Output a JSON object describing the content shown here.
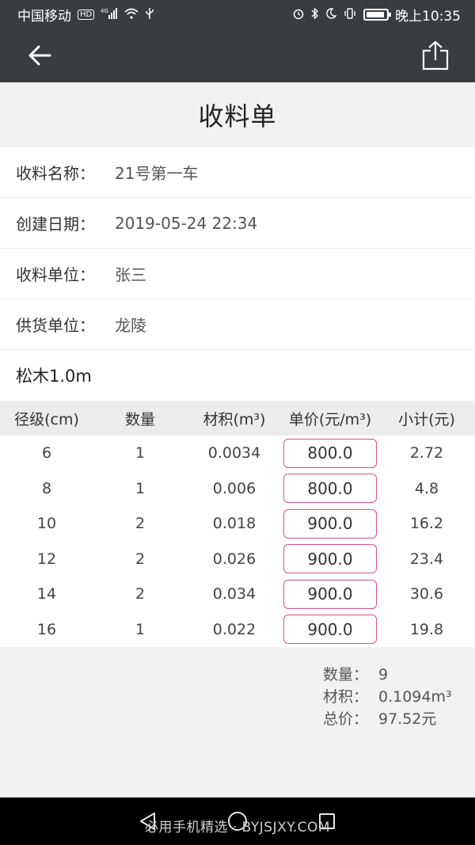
{
  "status_bar": {
    "carrier": "中国移动",
    "hd": "HD",
    "network": "4G",
    "time": "晚上10:35",
    "battery_level": 0.9
  },
  "app_bar": {
    "back_icon": "arrow-left-icon",
    "share_icon": "share-icon"
  },
  "page": {
    "title": "收料单"
  },
  "info": [
    {
      "label": "收料名称：",
      "value": "21号第一车"
    },
    {
      "label": "创建日期：",
      "value": "2019-05-24 22:34"
    },
    {
      "label": "收料单位：",
      "value": "张三"
    },
    {
      "label": "供货单位：",
      "value": "龙陵"
    }
  ],
  "section": {
    "title": "松木1.0m"
  },
  "table": {
    "headers": [
      "径级(cm)",
      "数量",
      "材积(m³)",
      "单价(元/m³)",
      "小计(元)"
    ],
    "rows": [
      {
        "diameter": "6",
        "qty": "1",
        "volume": "0.0034",
        "price": "800.0",
        "subtotal": "2.72"
      },
      {
        "diameter": "8",
        "qty": "1",
        "volume": "0.006",
        "price": "800.0",
        "subtotal": "4.8"
      },
      {
        "diameter": "10",
        "qty": "2",
        "volume": "0.018",
        "price": "900.0",
        "subtotal": "16.2"
      },
      {
        "diameter": "12",
        "qty": "2",
        "volume": "0.026",
        "price": "900.0",
        "subtotal": "23.4"
      },
      {
        "diameter": "14",
        "qty": "2",
        "volume": "0.034",
        "price": "900.0",
        "subtotal": "30.6"
      },
      {
        "diameter": "16",
        "qty": "1",
        "volume": "0.022",
        "price": "900.0",
        "subtotal": "19.8"
      }
    ]
  },
  "summary": {
    "qty_label": "数量：",
    "qty_value": "9",
    "volume_label": "材积：",
    "volume_value": "0.1094m³",
    "total_label": "总价：",
    "total_value": "97.52元"
  },
  "watermark": "必用手机精选 · BYJSJXY.COM",
  "colors": {
    "bar": "#3a3d40",
    "price_border": "#d8508a"
  }
}
